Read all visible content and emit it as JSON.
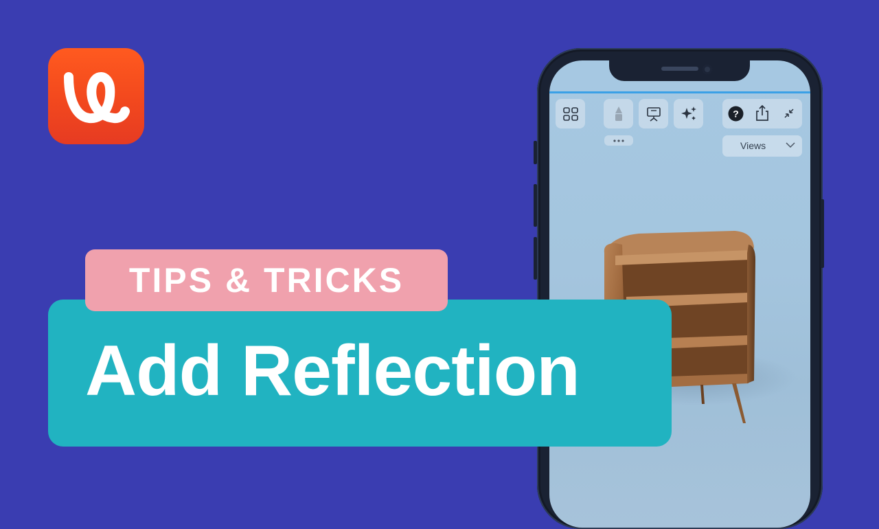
{
  "brand": {
    "logo": "app-logo",
    "colors": {
      "background": "#3a3db1",
      "logo": "#f2481e",
      "tips_badge": "#f0a1ad",
      "title_badge": "#21b3c1"
    }
  },
  "badge": {
    "label": "TIPS & TRICKS"
  },
  "title": {
    "text": "Add Reflection"
  },
  "app_toolbar": {
    "icons": [
      "grid-icon",
      "paint-bucket-icon",
      "presentation-icon",
      "sparkles-icon",
      "help-icon",
      "share-icon",
      "collapse-icon",
      "more-icon"
    ],
    "views_dropdown": {
      "label": "Views",
      "icon": "chevron-down-icon"
    }
  },
  "scene": {
    "object": "wooden-cabinet"
  }
}
